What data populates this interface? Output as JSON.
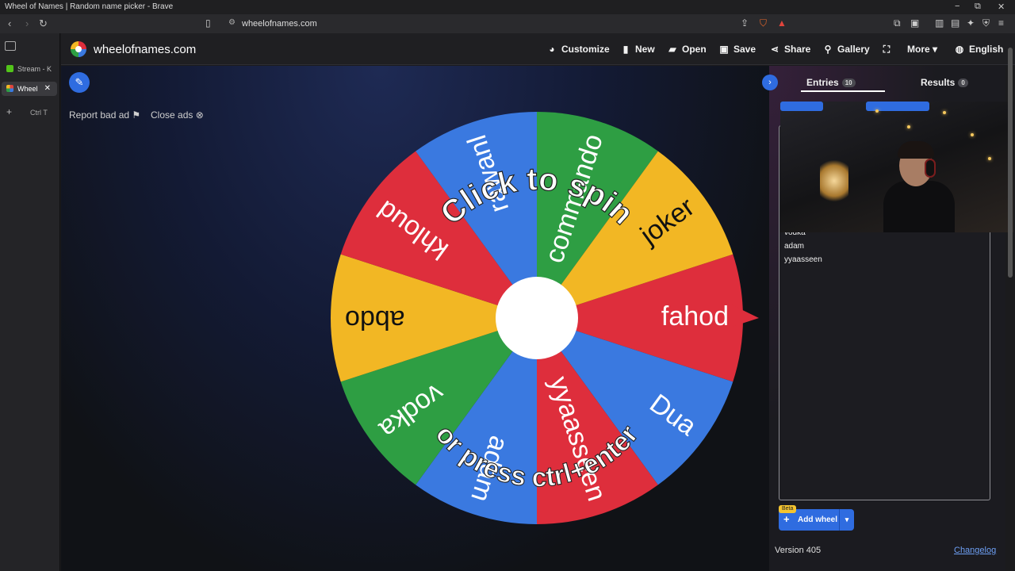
{
  "os": {
    "title": "Wheel of Names | Random name picker - Brave",
    "minimize": "−",
    "restore": "⧉",
    "close": "✕"
  },
  "browser": {
    "url": "wheelofnames.com",
    "tabs": [
      {
        "label": "Stream - K",
        "favicon_color": "#52c41a"
      },
      {
        "label": "Wheel",
        "favicon_color": "#e0443c"
      }
    ],
    "new_tab_hint": "Ctrl T"
  },
  "header": {
    "brand": "wheelofnames.com",
    "menu": [
      {
        "label": "Customize",
        "icon": "palette-icon",
        "glyph": "◕"
      },
      {
        "label": "New",
        "icon": "file-icon",
        "glyph": "▮"
      },
      {
        "label": "Open",
        "icon": "folder-icon",
        "glyph": "▰"
      },
      {
        "label": "Save",
        "icon": "save-icon",
        "glyph": "▣"
      },
      {
        "label": "Share",
        "icon": "share-icon",
        "glyph": "⋖"
      },
      {
        "label": "Gallery",
        "icon": "search-icon",
        "glyph": "⚲"
      },
      {
        "label": "",
        "icon": "fullscreen-icon",
        "glyph": "⛶"
      },
      {
        "label": "More",
        "icon": "chevron-down-icon",
        "glyph": "▾"
      },
      {
        "label": "English",
        "icon": "globe-icon",
        "glyph": "◍"
      }
    ]
  },
  "ads": {
    "report": "Report bad ad",
    "close": "Close ads"
  },
  "wheel": {
    "segments": [
      {
        "label": "fahod",
        "color": "#de2e3c"
      },
      {
        "label": "Dua",
        "color": "#3a79e0"
      },
      {
        "label": "yyaasseen",
        "color": "#de2e3c"
      },
      {
        "label": "adam",
        "color": "#3a79e0"
      },
      {
        "label": "vodka",
        "color": "#2e9e43"
      },
      {
        "label": "abdo",
        "color": "#f2b724"
      },
      {
        "label": "khloud",
        "color": "#de2e3c"
      },
      {
        "label": "rawanl",
        "color": "#3a79e0"
      },
      {
        "label": "commando",
        "color": "#2e9e43"
      },
      {
        "label": "joker",
        "color": "#f2b724"
      }
    ],
    "prompt_top": "Click to spin",
    "prompt_bottom": "or press ctrl+enter",
    "pointer_color": "#de2e3c"
  },
  "panel": {
    "entries_tab": "Entries",
    "entries_count": "10",
    "results_tab": "Results",
    "results_count": "0",
    "visible_entries": [
      "vodka",
      "adam",
      "yyaasseen"
    ],
    "add_wheel": "Add wheel",
    "beta": "Beta",
    "version": "Version 405",
    "changelog": "Changelog"
  },
  "colors": {
    "accent": "#2f6ce0"
  }
}
